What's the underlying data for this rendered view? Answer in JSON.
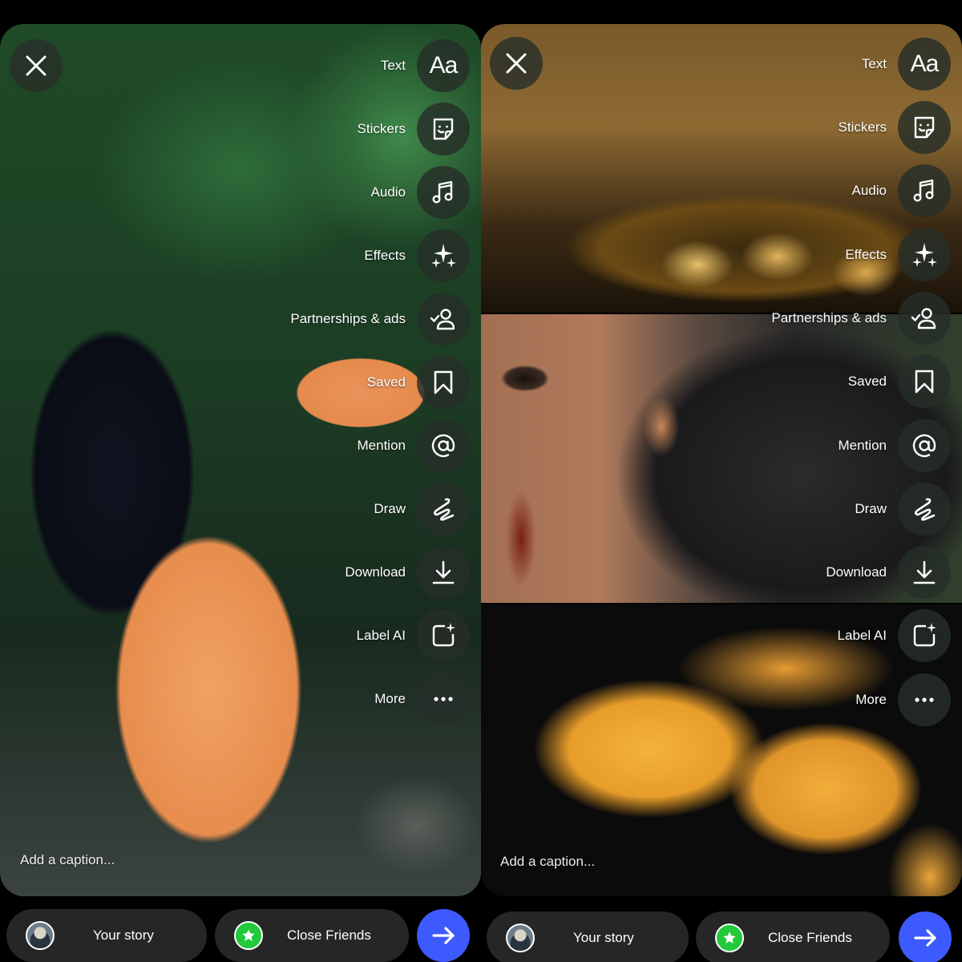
{
  "screens": [
    {
      "close_icon": "close-icon",
      "tools": [
        {
          "label": "Text",
          "icon": "text-aa-icon"
        },
        {
          "label": "Stickers",
          "icon": "sticker-icon"
        },
        {
          "label": "Audio",
          "icon": "music-note-icon"
        },
        {
          "label": "Effects",
          "icon": "sparkles-icon"
        },
        {
          "label": "Partnerships & ads",
          "icon": "person-check-icon"
        },
        {
          "label": "Saved",
          "icon": "bookmark-icon"
        },
        {
          "label": "Mention",
          "icon": "at-icon"
        },
        {
          "label": "Draw",
          "icon": "squiggle-icon"
        },
        {
          "label": "Download",
          "icon": "download-icon"
        },
        {
          "label": "Label AI",
          "icon": "ai-label-icon"
        },
        {
          "label": "More",
          "icon": "more-icon"
        }
      ],
      "caption_placeholder": "Add a caption...",
      "your_story": "Your story",
      "close_friends": "Close Friends"
    },
    {
      "close_icon": "close-icon",
      "tools": [
        {
          "label": "Text",
          "icon": "text-aa-icon"
        },
        {
          "label": "Stickers",
          "icon": "sticker-icon"
        },
        {
          "label": "Audio",
          "icon": "music-note-icon"
        },
        {
          "label": "Effects",
          "icon": "sparkles-icon"
        },
        {
          "label": "Partnerships & ads",
          "icon": "person-check-icon"
        },
        {
          "label": "Saved",
          "icon": "bookmark-icon"
        },
        {
          "label": "Mention",
          "icon": "at-icon"
        },
        {
          "label": "Draw",
          "icon": "squiggle-icon"
        },
        {
          "label": "Download",
          "icon": "download-icon"
        },
        {
          "label": "Label AI",
          "icon": "ai-label-icon"
        },
        {
          "label": "More",
          "icon": "more-icon"
        }
      ],
      "caption_placeholder": "Add a caption...",
      "your_story": "Your story",
      "close_friends": "Close Friends"
    }
  ],
  "colors": {
    "send_button": "#3d5afe",
    "close_friends_badge": "#22c93a",
    "pill_background": "#262626"
  },
  "tool_glyphs": {
    "text_aa": "Aa"
  }
}
